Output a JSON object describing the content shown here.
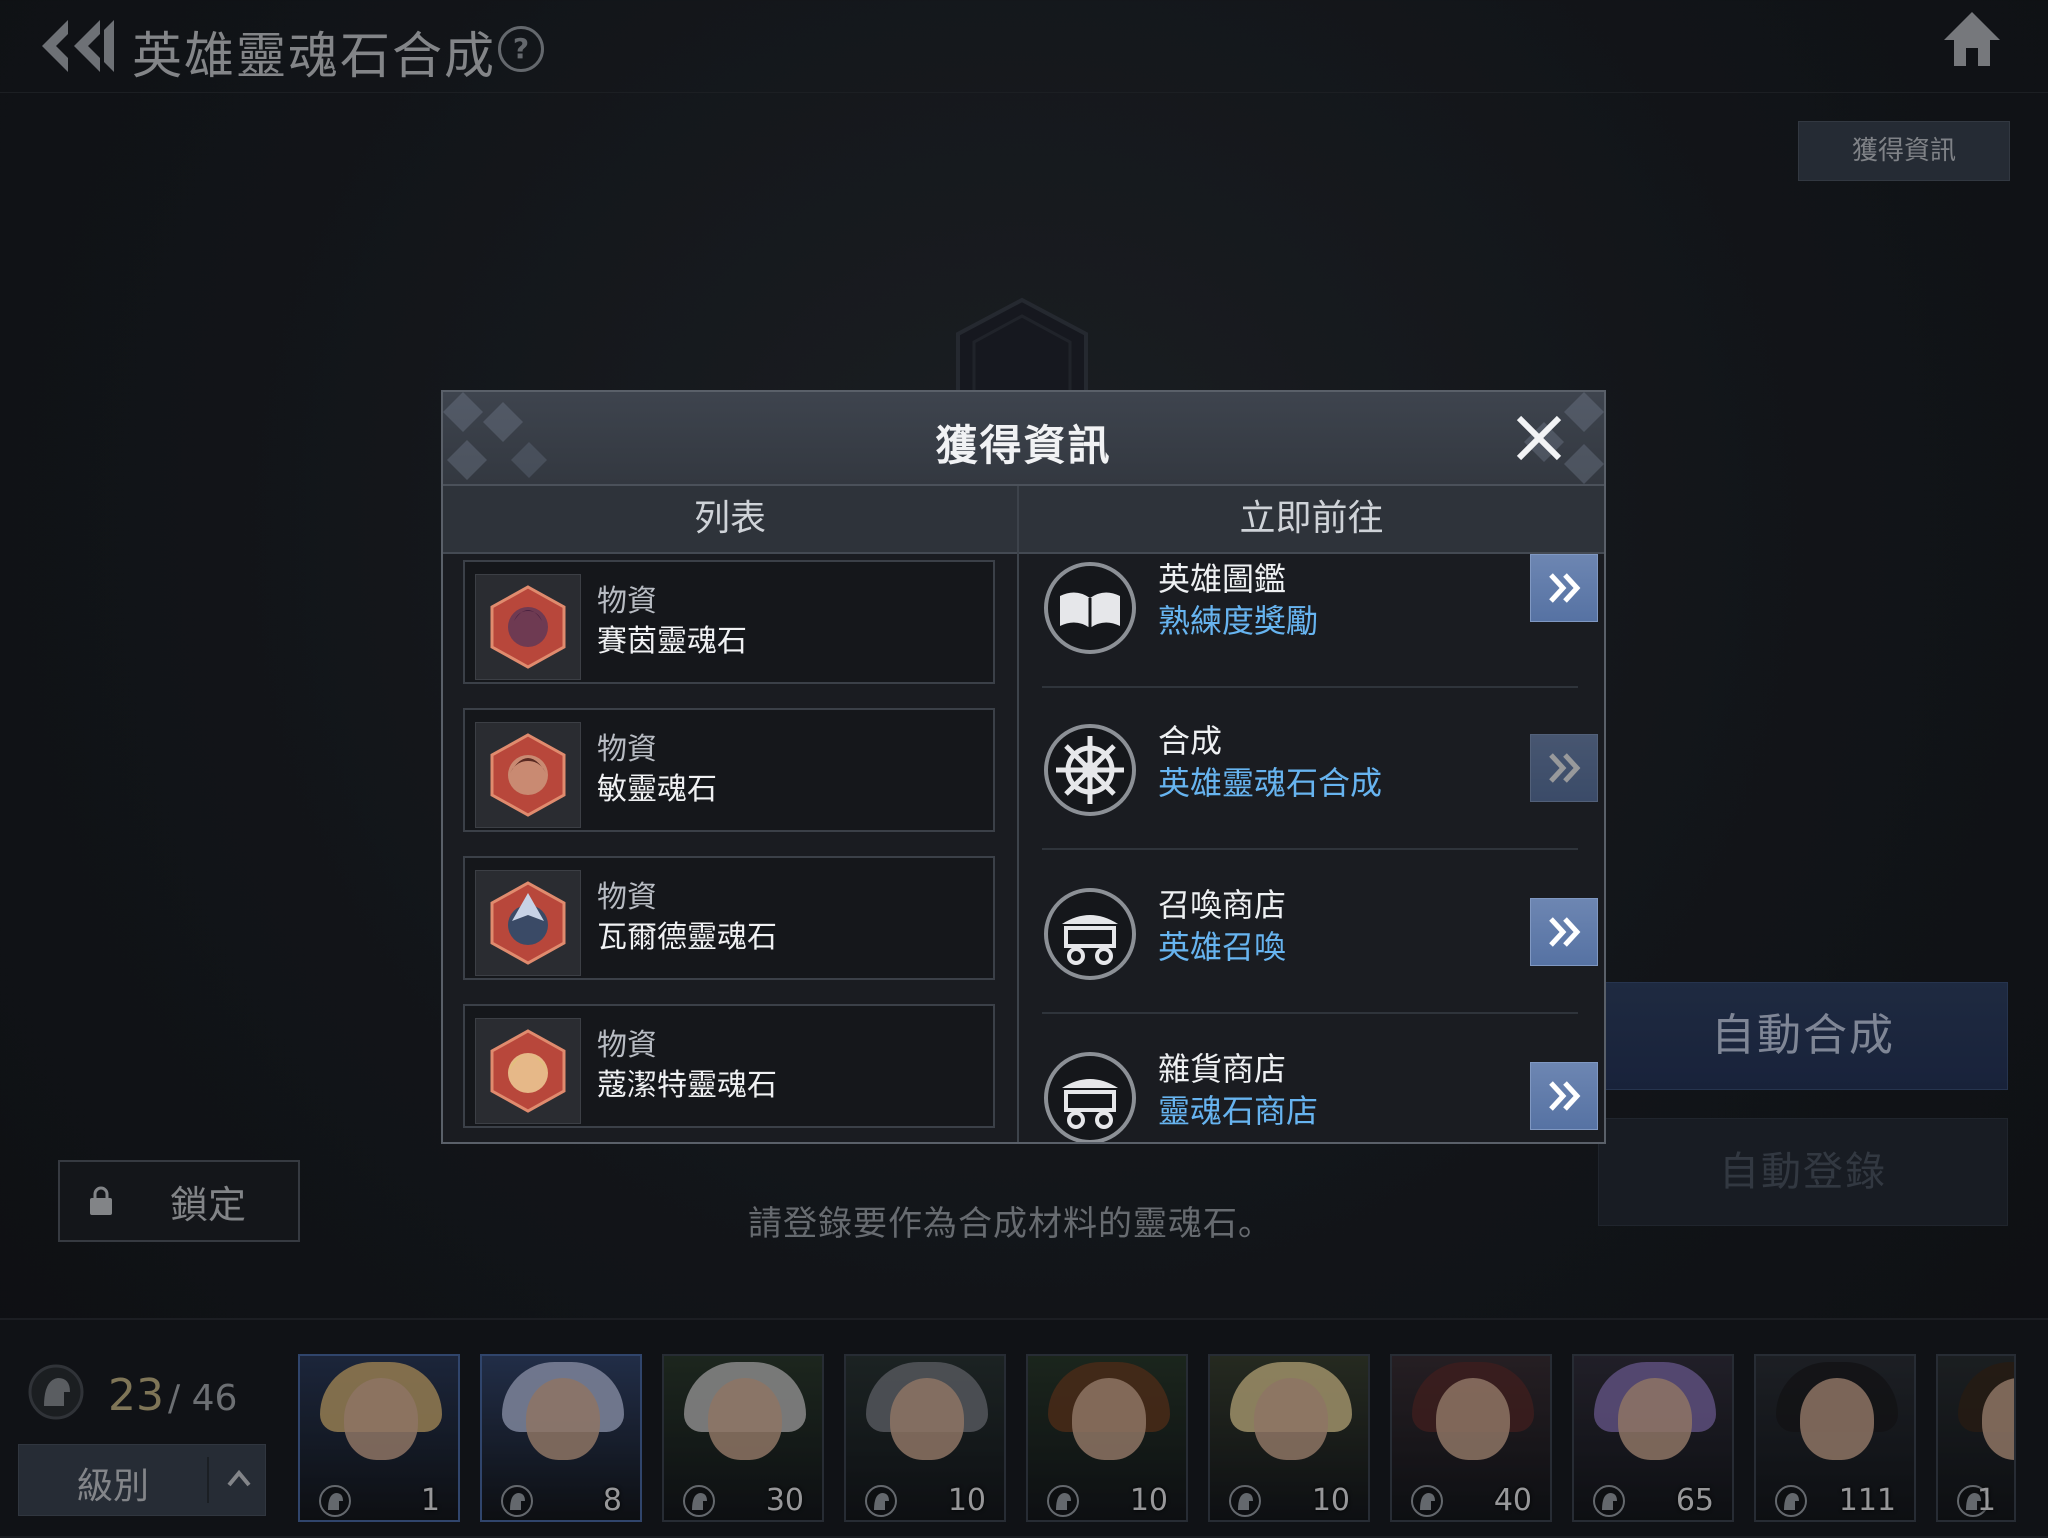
{
  "header": {
    "title": "英雄靈魂石合成",
    "help": "?"
  },
  "acquire_button": "獲得資訊",
  "actions": {
    "auto_synthesis": "自動合成",
    "auto_register": "自動登錄",
    "lock": "鎖定"
  },
  "instruction": "請登錄要作為合成材料的靈魂石。",
  "inventory": {
    "current": "23",
    "max": "/ 46",
    "level_label": "級別"
  },
  "heroes": [
    {
      "level": "1",
      "hair": "#d9b77a",
      "bg": "#2b3a5a",
      "selected": true
    },
    {
      "level": "8",
      "hair": "#b9c3e6",
      "bg": "#34466e",
      "selected": true
    },
    {
      "level": "30",
      "hair": "#c9c9c9",
      "bg": "#2c3b2e",
      "selected": false
    },
    {
      "level": "10",
      "hair": "#7b8087",
      "bg": "#2b3636",
      "selected": false
    },
    {
      "level": "10",
      "hair": "#6b4025",
      "bg": "#2a3a2c",
      "selected": false
    },
    {
      "level": "10",
      "hair": "#e8d49a",
      "bg": "#3a4132",
      "selected": false
    },
    {
      "level": "40",
      "hair": "#5a2e2e",
      "bg": "#3a2f36",
      "selected": false
    },
    {
      "level": "65",
      "hair": "#8a74b8",
      "bg": "#33303e",
      "selected": false
    },
    {
      "level": "111",
      "hair": "#1e1e22",
      "bg": "#2c3038",
      "selected": false
    },
    {
      "level": "1",
      "hair": "#3a2a1e",
      "bg": "#2a2f33",
      "selected": false
    }
  ],
  "dialog": {
    "title": "獲得資訊",
    "col_list": "列表",
    "col_go": "立即前往",
    "items": [
      {
        "category": "物資",
        "name": "賽茵靈魂石"
      },
      {
        "category": "物資",
        "name": "敏靈魂石"
      },
      {
        "category": "物資",
        "name": "瓦爾德靈魂石"
      },
      {
        "category": "物資",
        "name": "蔻潔特靈魂石"
      }
    ],
    "routes": [
      {
        "category": "英雄圖鑑",
        "destination": "熟練度獎勵",
        "icon": "book-icon"
      },
      {
        "category": "合成",
        "destination": "英雄靈魂石合成",
        "icon": "wheel-icon"
      },
      {
        "category": "召喚商店",
        "destination": "英雄召喚",
        "icon": "cart-icon"
      },
      {
        "category": "雜貨商店",
        "destination": "靈魂石商店",
        "icon": "cart-icon"
      }
    ]
  },
  "colors": {
    "accent_blue": "#67b4f0",
    "button_blue": "#5672a3",
    "gold": "#c4b486"
  }
}
